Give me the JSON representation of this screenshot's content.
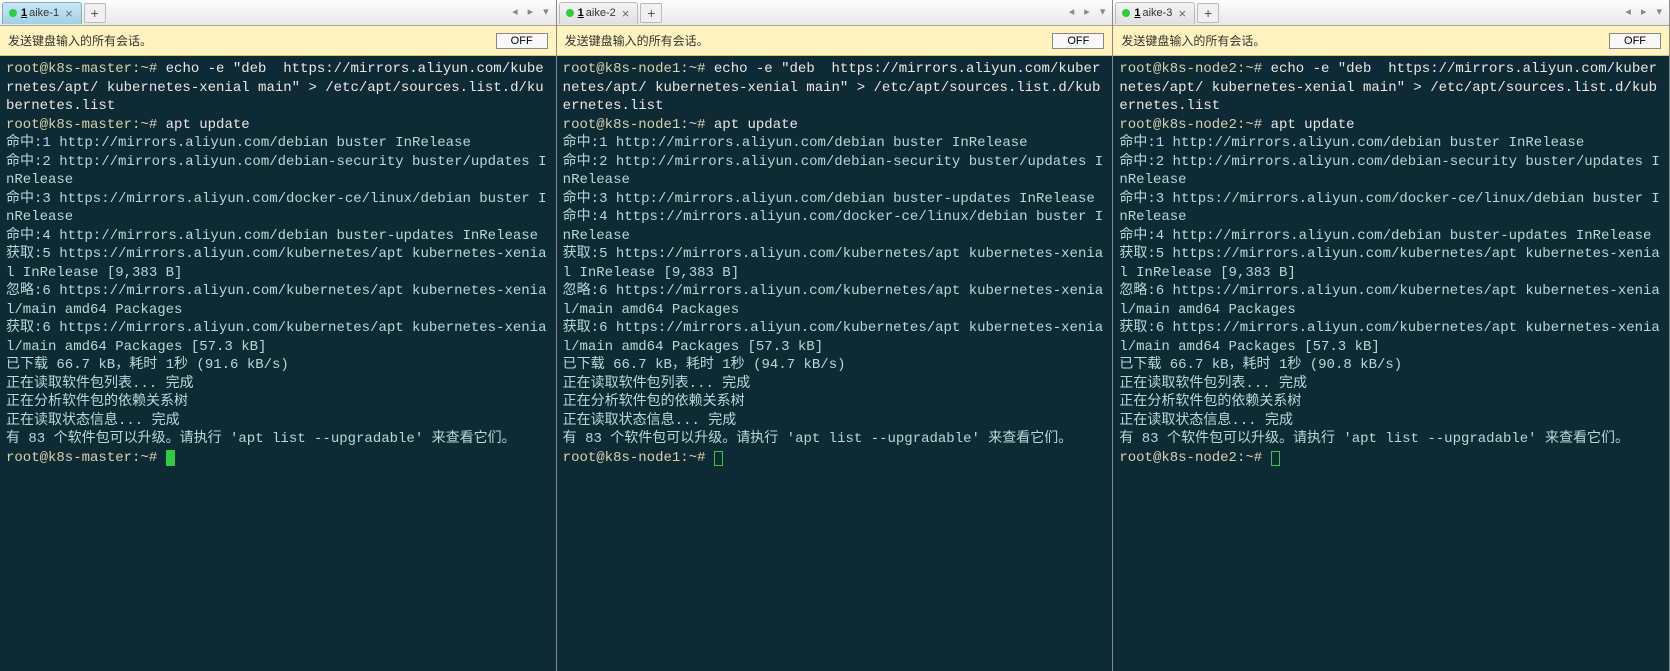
{
  "banner": {
    "text": "发送键盘输入的所有会话。",
    "button": "OFF"
  },
  "nav": {
    "prev": "◂",
    "next": "▸",
    "dropdown": "▾"
  },
  "tab_add": "+",
  "tab_close": "×",
  "panes": [
    {
      "tab": {
        "num": "1",
        "label": "aike-1"
      },
      "lines": [
        {
          "prompt": "root@k8s-master:~#",
          "cmd": " echo -e \"deb  https://mirrors.aliyun.com/kubernetes/apt/ kubernetes-xenial main\" > /etc/apt/sources.list.d/kubernetes.list"
        },
        {
          "prompt": "root@k8s-master:~#",
          "cmd": " apt update"
        },
        {
          "out": "命中:1 http://mirrors.aliyun.com/debian buster InRelease"
        },
        {
          "out": "命中:2 http://mirrors.aliyun.com/debian-security buster/updates InRelease"
        },
        {
          "out": "命中:3 https://mirrors.aliyun.com/docker-ce/linux/debian buster InRelease"
        },
        {
          "out": "命中:4 http://mirrors.aliyun.com/debian buster-updates InRelease"
        },
        {
          "out": "获取:5 https://mirrors.aliyun.com/kubernetes/apt kubernetes-xenial InRelease [9,383 B]"
        },
        {
          "out": "忽略:6 https://mirrors.aliyun.com/kubernetes/apt kubernetes-xenial/main amd64 Packages"
        },
        {
          "out": "获取:6 https://mirrors.aliyun.com/kubernetes/apt kubernetes-xenial/main amd64 Packages [57.3 kB]"
        },
        {
          "out": "已下载 66.7 kB，耗时 1秒 (91.6 kB/s)"
        },
        {
          "out": "正在读取软件包列表... 完成"
        },
        {
          "out": "正在分析软件包的依赖关系树"
        },
        {
          "out": "正在读取状态信息... 完成"
        },
        {
          "out": "有 83 个软件包可以升级。请执行 'apt list --upgradable' 来查看它们。"
        },
        {
          "prompt": "root@k8s-master:~#",
          "cmd": " ",
          "cursor": "block"
        }
      ]
    },
    {
      "tab": {
        "num": "1",
        "label": "aike-2"
      },
      "lines": [
        {
          "prompt": "root@k8s-node1:~#",
          "cmd": " echo -e \"deb  https://mirrors.aliyun.com/kubernetes/apt/ kubernetes-xenial main\" > /etc/apt/sources.list.d/kubernetes.list"
        },
        {
          "prompt": "root@k8s-node1:~#",
          "cmd": " apt update"
        },
        {
          "out": "命中:1 http://mirrors.aliyun.com/debian buster InRelease"
        },
        {
          "out": "命中:2 http://mirrors.aliyun.com/debian-security buster/updates InRelease"
        },
        {
          "out": "命中:3 http://mirrors.aliyun.com/debian buster-updates InRelease"
        },
        {
          "out": "命中:4 https://mirrors.aliyun.com/docker-ce/linux/debian buster InRelease"
        },
        {
          "out": "获取:5 https://mirrors.aliyun.com/kubernetes/apt kubernetes-xenial InRelease [9,383 B]"
        },
        {
          "out": "忽略:6 https://mirrors.aliyun.com/kubernetes/apt kubernetes-xenial/main amd64 Packages"
        },
        {
          "out": "获取:6 https://mirrors.aliyun.com/kubernetes/apt kubernetes-xenial/main amd64 Packages [57.3 kB]"
        },
        {
          "out": "已下载 66.7 kB，耗时 1秒 (94.7 kB/s)"
        },
        {
          "out": "正在读取软件包列表... 完成"
        },
        {
          "out": "正在分析软件包的依赖关系树"
        },
        {
          "out": "正在读取状态信息... 完成"
        },
        {
          "out": "有 83 个软件包可以升级。请执行 'apt list --upgradable' 来查看它们。"
        },
        {
          "prompt": "root@k8s-node1:~#",
          "cmd": " ",
          "cursor": "outline"
        }
      ]
    },
    {
      "tab": {
        "num": "1",
        "label": "aike-3"
      },
      "lines": [
        {
          "prompt": "root@k8s-node2:~#",
          "cmd": " echo -e \"deb  https://mirrors.aliyun.com/kubernetes/apt/ kubernetes-xenial main\" > /etc/apt/sources.list.d/kubernetes.list"
        },
        {
          "prompt": "root@k8s-node2:~#",
          "cmd": " apt update"
        },
        {
          "out": "命中:1 http://mirrors.aliyun.com/debian buster InRelease"
        },
        {
          "out": "命中:2 http://mirrors.aliyun.com/debian-security buster/updates InRelease"
        },
        {
          "out": "命中:3 https://mirrors.aliyun.com/docker-ce/linux/debian buster InRelease"
        },
        {
          "out": "命中:4 http://mirrors.aliyun.com/debian buster-updates InRelease"
        },
        {
          "out": "获取:5 https://mirrors.aliyun.com/kubernetes/apt kubernetes-xenial InRelease [9,383 B]"
        },
        {
          "out": "忽略:6 https://mirrors.aliyun.com/kubernetes/apt kubernetes-xenial/main amd64 Packages"
        },
        {
          "out": "获取:6 https://mirrors.aliyun.com/kubernetes/apt kubernetes-xenial/main amd64 Packages [57.3 kB]"
        },
        {
          "out": "已下载 66.7 kB，耗时 1秒 (90.8 kB/s)"
        },
        {
          "out": "正在读取软件包列表... 完成"
        },
        {
          "out": "正在分析软件包的依赖关系树"
        },
        {
          "out": "正在读取状态信息... 完成"
        },
        {
          "out": "有 83 个软件包可以升级。请执行 'apt list --upgradable' 来查看它们。"
        },
        {
          "prompt": "root@k8s-node2:~#",
          "cmd": " ",
          "cursor": "outline"
        }
      ]
    }
  ]
}
